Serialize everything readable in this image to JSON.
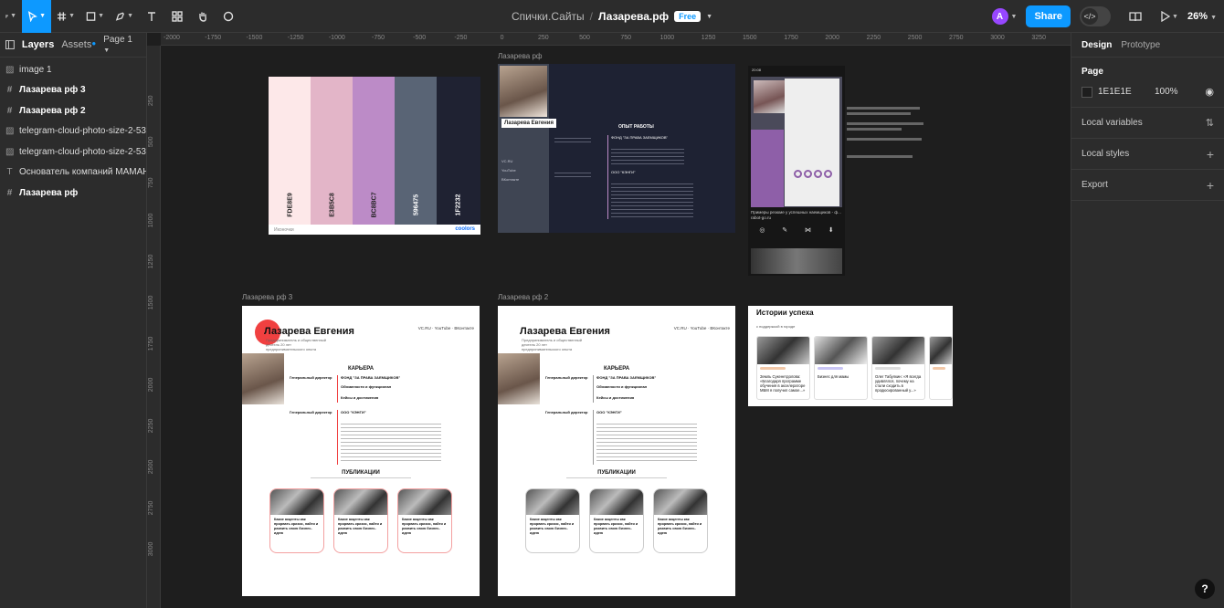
{
  "topbar": {
    "project": "Спички.Сайты",
    "separator": "/",
    "file_name": "Лазарева.рф",
    "plan_badge": "Free",
    "avatar_initial": "A",
    "share_label": "Share",
    "dev_mode_label": "</>",
    "zoom": "26%",
    "tools": [
      "main-menu-icon",
      "move-tool-icon",
      "frame-tool-icon",
      "shape-tool-icon",
      "pen-tool-icon",
      "text-tool-icon",
      "resources-icon",
      "hand-tool-icon",
      "comment-icon"
    ],
    "accent": "#0d99ff"
  },
  "left_panel": {
    "tabs": {
      "layers": "Layers",
      "assets": "Assets"
    },
    "page": "Page 1",
    "layers": [
      {
        "name": "image 1",
        "icon": "image-icon",
        "bold": false
      },
      {
        "name": "Лазарева рф 3",
        "icon": "frame-icon",
        "bold": true
      },
      {
        "name": "Лазарева рф 2",
        "icon": "frame-icon",
        "bold": true
      },
      {
        "name": "telegram-cloud-photo-size-2-539...",
        "icon": "image-icon",
        "bold": false
      },
      {
        "name": "telegram-cloud-photo-size-2-537...",
        "icon": "image-icon",
        "bold": false
      },
      {
        "name": "Основатель компаний МАМАНО...",
        "icon": "text-icon",
        "bold": false
      },
      {
        "name": "Лазарева рф",
        "icon": "frame-icon",
        "bold": true
      }
    ]
  },
  "canvas": {
    "ruler_top": [
      "-2000",
      "-1750",
      "-1500",
      "-1250",
      "-1000",
      "-750",
      "-500",
      "-250",
      "0",
      "250",
      "500",
      "750",
      "1000",
      "1250",
      "1500",
      "1750",
      "2000",
      "2250",
      "2500",
      "2750",
      "3000",
      "3250"
    ],
    "ruler_left": [
      "250",
      "500",
      "750",
      "1000",
      "1250",
      "1500",
      "1750",
      "2000",
      "2250",
      "2500",
      "2750",
      "3000"
    ],
    "frame_labels": {
      "f1": "Лазарева рф",
      "f3": "Лазарева рф 3",
      "f2": "Лазарева рф 2"
    },
    "palette": {
      "swatches": [
        {
          "hex": "#FDE8E9",
          "label": "FDE8E9"
        },
        {
          "hex": "#E3B5C8",
          "label": "E3B5C8"
        },
        {
          "hex": "#BC8BC7",
          "label": "BC8BC7"
        },
        {
          "hex": "#596475",
          "label": "596475"
        },
        {
          "hex": "#1F2232",
          "label": "1F2232"
        }
      ],
      "footer_left": "Иконочки",
      "footer_brand": "coolors"
    },
    "dark_resume": {
      "name_tag": "Лазарева Евгения",
      "heading": "ОПЫТ РАБОТЫ",
      "org1": "ФОНД \"ЗА ПРАВА ЗАЕМЩИКОВ\"",
      "org2": "ООО \"КЭНГИ\"",
      "links": [
        "VC.RU",
        "YouTube",
        "ВКонтакте"
      ]
    },
    "phone": {
      "time": "20:08",
      "caption": "Примеры резюме у успешных наемщиков - ф...",
      "site": "rabot-go.ru"
    },
    "white_resume": {
      "name": "Лазарева Евгения",
      "subtitle": "Предприниматель и общественный деятель 20 лет предпринимательского опыта",
      "links": [
        "VC.RU",
        "YouTube",
        "ВКонтакте"
      ],
      "career": "КАРЬЕРА",
      "role1": "Генеральный директор",
      "org1": "ФОНД \"ЗА ПРАВА ЗАЕМЩИКОВ\"",
      "role2": "Генеральный директор",
      "org2": "ООО \"КЭНГИ\"",
      "resp": "Обязанности и функционал",
      "achievements": "Кейсы и достижения",
      "publications": "ПУБЛИКАЦИИ",
      "card_text": "Какие акценты как прорвать кризис, найти и развить свою бизнес-идею",
      "card_tag": "VC.RU"
    },
    "success": {
      "title": "Истории успеха",
      "subtitle": "с поддержкой в городе",
      "cards": [
        "Земль Сукенетдолова: «Благодаря программе обучения в акселераторе МБМ я получил самое...»",
        "Бизнес для мамы",
        "Олег Табулкин: «Я всегда удивлялся, почему на стали сходить в продюсированный у...»"
      ]
    }
  },
  "right_panel": {
    "tabs": {
      "design": "Design",
      "prototype": "Prototype"
    },
    "page_section": "Page",
    "page_color": "1E1E1E",
    "page_opacity": "100%",
    "sections": [
      "Local variables",
      "Local styles",
      "Export"
    ]
  },
  "help_label": "?"
}
